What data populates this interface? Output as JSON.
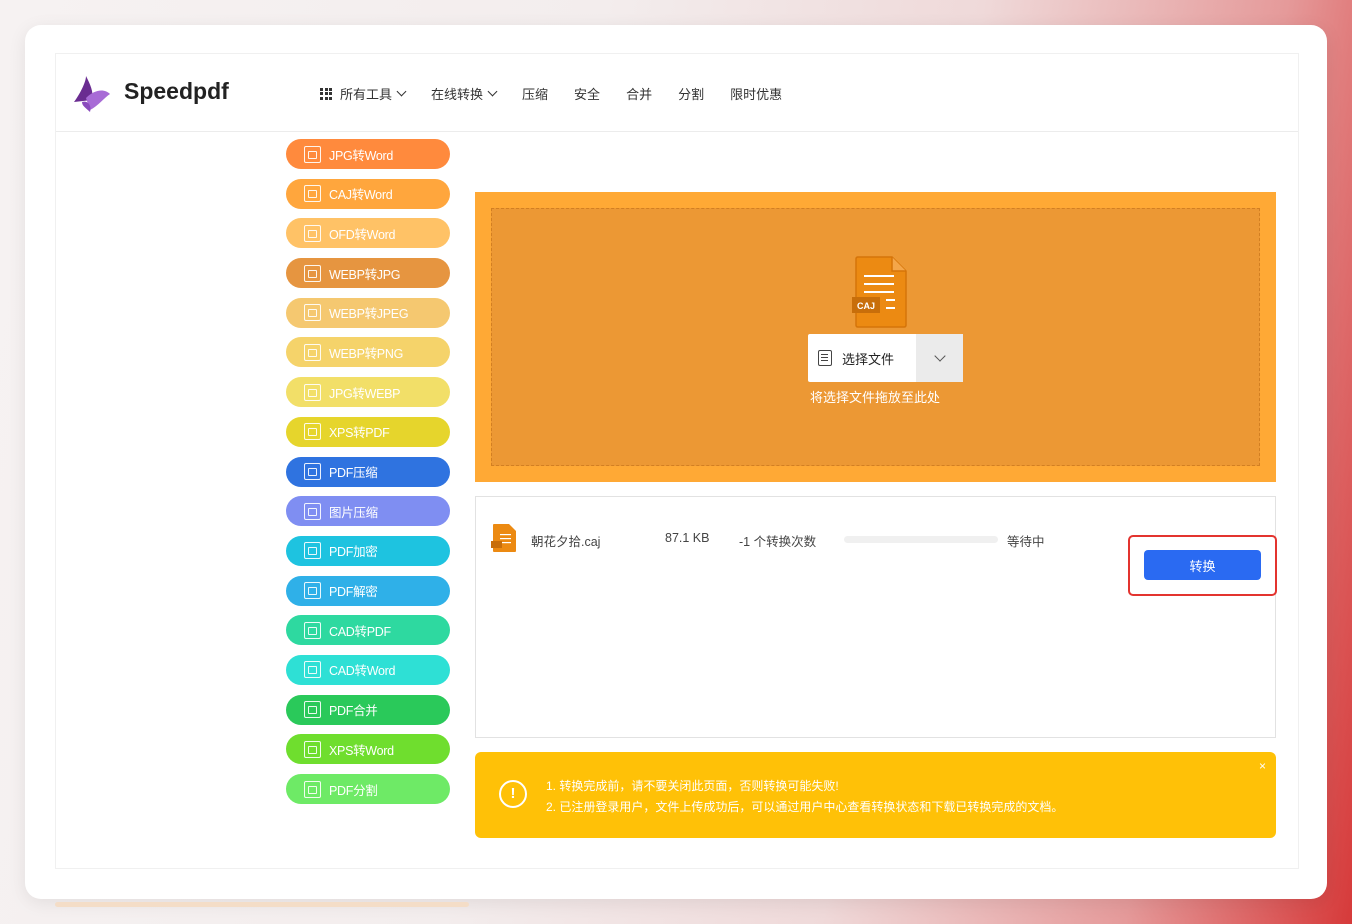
{
  "header": {
    "logo_text": "Speedpdf",
    "nav": [
      {
        "label": "所有工具",
        "has_dropdown": true,
        "icon": "grid-icon"
      },
      {
        "label": "在线转换",
        "has_dropdown": true
      },
      {
        "label": "压缩"
      },
      {
        "label": "安全"
      },
      {
        "label": "合并"
      },
      {
        "label": "分割"
      },
      {
        "label": "限时优惠"
      }
    ]
  },
  "sidebar": {
    "items": [
      {
        "label": "JPG转Word",
        "color": "#ff8a3d"
      },
      {
        "label": "CAJ转Word",
        "color": "#ffa63d"
      },
      {
        "label": "OFD转Word",
        "color": "#ffc266"
      },
      {
        "label": "WEBP转JPG",
        "color": "#e69540"
      },
      {
        "label": "WEBP转JPEG",
        "color": "#f5c870"
      },
      {
        "label": "WEBP转PNG",
        "color": "#f5d36a"
      },
      {
        "label": "JPG转WEBP",
        "color": "#f2df68"
      },
      {
        "label": "XPS转PDF",
        "color": "#e6d52c"
      },
      {
        "label": "PDF压缩",
        "color": "#2f73e0"
      },
      {
        "label": "图片压缩",
        "color": "#7f8ef2"
      },
      {
        "label": "PDF加密",
        "color": "#1ec3e0"
      },
      {
        "label": "PDF解密",
        "color": "#2fb0e8"
      },
      {
        "label": "CAD转PDF",
        "color": "#2ed9a0"
      },
      {
        "label": "CAD转Word",
        "color": "#2ee0d5"
      },
      {
        "label": "PDF合并",
        "color": "#2ac95a"
      },
      {
        "label": "XPS转Word",
        "color": "#6fde2e"
      },
      {
        "label": "PDF分割",
        "color": "#6eea66"
      }
    ]
  },
  "upload": {
    "file_badge": "CAJ",
    "select_label": "选择文件",
    "drop_hint": "将选择文件拖放至此处"
  },
  "file": {
    "name": "朝花夕拾.caj",
    "size": "87.1 KB",
    "count": "-1 个转换次数",
    "progress": 0,
    "status": "等待中",
    "convert_label": "转换"
  },
  "notice": {
    "icon": "!",
    "line1": "1. 转换完成前，请不要关闭此页面，否则转换可能失败!",
    "line2": "2. 已注册登录用户，文件上传成功后，可以通过用户中心查看转换状态和下载已转换完成的文档。",
    "close": "×"
  }
}
